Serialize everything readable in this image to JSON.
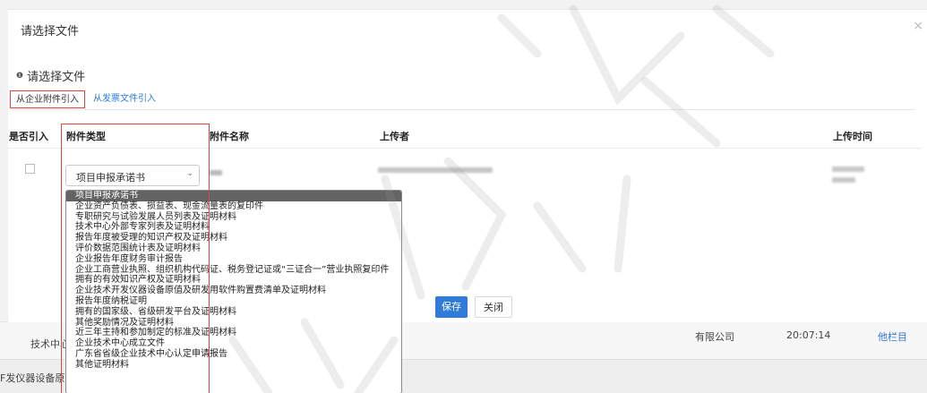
{
  "dialog": {
    "title": "请选择文件",
    "close_glyph": "×",
    "section_title": "请选择文件",
    "section_bullet": "❶"
  },
  "tabs": [
    {
      "label": "从企业附件引入",
      "active": true
    },
    {
      "label": "从发票文件引入",
      "active": false
    }
  ],
  "table": {
    "headers": [
      "是否引入",
      "附件类型",
      "附件名称",
      "上传者",
      "上传时间"
    ]
  },
  "row": {
    "type_selected": "项目申报承诺书"
  },
  "dropdown_options": [
    "项目申报承诺书",
    "企业资产负债表、损益表、现金流量表的复印件",
    "专职研究与试验发展人员列表及证明材料",
    "技术中心外部专家列表及证明材料",
    "报告年度被受理的知识产权及证明材料",
    "评价数据范围统计表及证明材料",
    "企业报告年度财务审计报告",
    "企业工商营业执照、组织机构代码证、税务登记证或“三证合一”营业执照复印件",
    "拥有的有效知识产权及证明材料",
    "企业技术开发仪器设备原值及研发用软件购置费清单及证明材料",
    "报告年度纳税证明",
    "拥有的国家级、省级研发平台及证明材料",
    "其他奖励情况及证明材料",
    "近三年主持和参加制定的标准及证明材料",
    "企业技术中心成立文件",
    "广东省省级企业技术中心认定申请报告",
    "其他证明材料"
  ],
  "buttons": {
    "save": "保存",
    "close": "关闭"
  },
  "background": {
    "row1_left": "技术中心",
    "row2_left": "F发仪器设备原",
    "company_suffix": "有限公司",
    "time": "20:07:14",
    "link": "他栏目"
  },
  "colors": {
    "accent_blue": "#2f7bd8",
    "highlight_red": "#e0443c",
    "selected_option_bg": "#636363"
  }
}
